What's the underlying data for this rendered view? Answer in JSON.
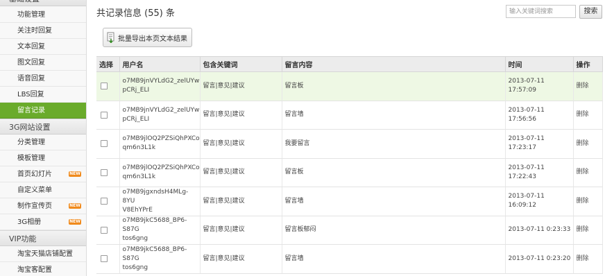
{
  "sidebar": {
    "group_top": "基础设置",
    "items_a": [
      {
        "label": "功能管理"
      },
      {
        "label": "关注时回复"
      },
      {
        "label": "文本回复"
      },
      {
        "label": "图文回复"
      },
      {
        "label": "语音回复"
      },
      {
        "label": "LBS回复"
      },
      {
        "label": "留言记录",
        "active": true
      }
    ],
    "group_3g": "3G网站设置",
    "items_b": [
      {
        "label": "分类管理"
      },
      {
        "label": "模板管理"
      },
      {
        "label": "首页幻灯片",
        "badge": "NEW"
      },
      {
        "label": "自定义菜单"
      },
      {
        "label": "制作宣传页",
        "badge": "NEW"
      },
      {
        "label": "3G相册",
        "badge": "NEW"
      }
    ],
    "group_vip": "VIP功能",
    "items_c": [
      {
        "label": "淘宝天猫店铺配置"
      },
      {
        "label": "淘宝客配置"
      }
    ]
  },
  "header": {
    "title": "共记录信息 (55) 条",
    "search_placeholder": "输入关键词搜索",
    "search_button": "搜索",
    "export_button": "批量导出本页文本结果"
  },
  "table": {
    "columns": [
      "选择",
      "用户名",
      "包含关键词",
      "留言内容",
      "时间",
      "操作"
    ],
    "rows": [
      {
        "user_line1": "o7MB9jnVYLdG2_zelUYw",
        "user_line2": "pCRj_ELI",
        "keywords": "留言|意见|建议",
        "content": "留言板",
        "time": "2013-07-11 17:57:09",
        "action": "删除",
        "highlight": true
      },
      {
        "user_line1": "o7MB9jnVYLdG2_zelUYw",
        "user_line2": "pCRj_ELI",
        "keywords": "留言|意见|建议",
        "content": "留言墙",
        "time": "2013-07-11 17:56:56",
        "action": "删除"
      },
      {
        "user_line1": "o7MB9jlOQ2PZSiQhPXCo",
        "user_line2": "qm6n3L1k",
        "keywords": "留言|意见|建议",
        "content": "我要留言",
        "time": "2013-07-11 17:23:17",
        "action": "删除"
      },
      {
        "user_line1": "o7MB9jlOQ2PZSiQhPXCo",
        "user_line2": "qm6n3L1k",
        "keywords": "留言|意见|建议",
        "content": "留言板",
        "time": "2013-07-11 17:22:43",
        "action": "删除"
      },
      {
        "user_line1": "o7MB9jgxndsH4MLg-8YU",
        "user_line2": "V8EhYPrE",
        "keywords": "留言|意见|建议",
        "content": "留言墙",
        "time": "2013-07-11 16:09:12",
        "action": "删除"
      },
      {
        "user_line1": "o7MB9jkC5688_BP6-S87G",
        "user_line2": "tos6gng",
        "keywords": "留言|意见|建议",
        "content": "留言板郁闷",
        "time": "2013-07-11 0:23:33",
        "action": "删除"
      },
      {
        "user_line1": "o7MB9jkC5688_BP6-S87G",
        "user_line2": "tos6gng",
        "keywords": "留言|意见|建议",
        "content": "留言墙",
        "time": "2013-07-11 0:23:20",
        "action": "删除"
      }
    ]
  },
  "colors": {
    "accent_green": "#6aab2b",
    "badge_orange": "#f08a1c",
    "row_highlight": "#eef8e4"
  },
  "icons": {
    "export": "document-export-icon",
    "new_badge": "new-badge-icon"
  }
}
